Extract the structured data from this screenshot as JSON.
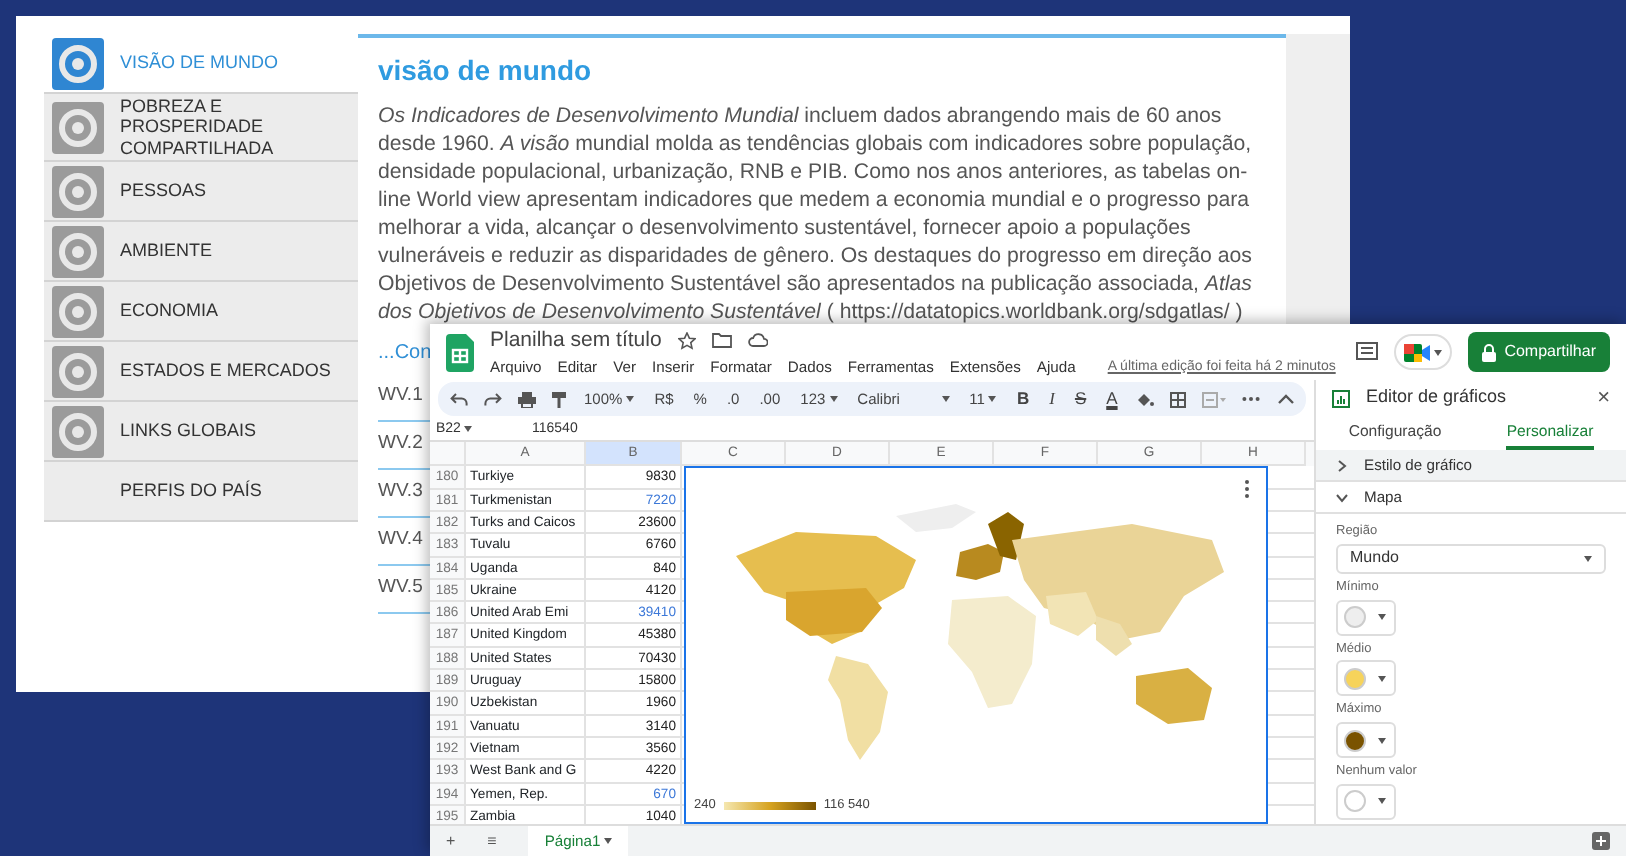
{
  "webpage": {
    "sidebar": [
      {
        "label": "VISÃO DE MUNDO",
        "kind": "icon",
        "selected": true
      },
      {
        "label": "POBREZA E PROSPERIDADE COMPARTILHADA",
        "kind": "icon",
        "selected": false
      },
      {
        "label": "PESSOAS",
        "kind": "icon",
        "selected": false
      },
      {
        "label": "AMBIENTE",
        "kind": "icon",
        "selected": false
      },
      {
        "label": "ECONOMIA",
        "kind": "icon",
        "selected": false
      },
      {
        "label": "ESTADOS E MERCADOS",
        "kind": "icon",
        "selected": false
      },
      {
        "label": "LINKS GLOBAIS",
        "kind": "icon",
        "selected": false
      },
      {
        "label": "PERFIS DO PAÍS",
        "kind": "text",
        "selected": false
      }
    ],
    "title": "visão de mundo",
    "paragraph": "*Os Indicadores de Desenvolvimento Mundial* incluem dados abrangendo mais de 60 anos desde 1960. *A visão* mundial molda as tendências globais com indicadores sobre população, densidade populacional, urbanização, RNB e PIB. Como nos anos anteriores, as tabelas on-line World view apresentam indicadores que medem a economia mundial e o progresso para melhorar a vida, alcançar o desenvolvimento sustentável, fornecer apoio a populações vulneráveis e reduzir as disparidades de gênero. Os destaques do progresso em direção aos Objetivos de Desenvolvimento Sustentável são apresentados na publicação associada, *Atlas dos Objetivos de Desenvolvimento Sustentável* (",
    "link": "https://datatopics.worldbank.org/sdgatlas/",
    "link_suffix": ")",
    "more_link": "...Con",
    "table_labels": [
      "WV.1",
      "WV.2",
      "WV.3",
      "WV.4",
      "WV.5"
    ]
  },
  "sheets": {
    "title": "Planilha sem título",
    "menu": [
      "Arquivo",
      "Editar",
      "Ver",
      "Inserir",
      "Formatar",
      "Dados",
      "Ferramentas",
      "Extensões",
      "Ajuda"
    ],
    "last_edit": "A última edição foi feita há 2 minutos",
    "share_button": "Compartilhar",
    "toolbar": [
      {
        "kind": "dropdown",
        "text": "100%"
      },
      {
        "kind": "button",
        "text": "R$"
      },
      {
        "kind": "button",
        "text": "%"
      },
      {
        "kind": "button",
        "text": ".0"
      },
      {
        "kind": "button",
        "text": ".00"
      },
      {
        "kind": "dropdown",
        "text": "123"
      },
      {
        "kind": "dropdown",
        "text": "Calibri"
      },
      {
        "kind": "dropdown",
        "text": "11"
      }
    ],
    "format_buttons": [
      "B",
      "I",
      "S",
      "A"
    ],
    "cell_ref": "B22",
    "formula": "116540",
    "columns": [
      {
        "label": "A",
        "selected": false
      },
      {
        "label": "B",
        "selected": true
      },
      {
        "label": "C",
        "selected": false
      },
      {
        "label": "D",
        "selected": false
      },
      {
        "label": "E",
        "selected": false
      },
      {
        "label": "F",
        "selected": false
      },
      {
        "label": "G",
        "selected": false
      },
      {
        "label": "H",
        "selected": false
      }
    ],
    "rows": [
      {
        "num": "180",
        "name": "Turkiye",
        "value": "9830",
        "color": "#222222"
      },
      {
        "num": "181",
        "name": "Turkmenistan",
        "value": "7220",
        "color": "#3c78d8"
      },
      {
        "num": "182",
        "name": "Turks and Caicos",
        "value": "23600",
        "color": "#222222"
      },
      {
        "num": "183",
        "name": "Tuvalu",
        "value": "6760",
        "color": "#222222"
      },
      {
        "num": "184",
        "name": "Uganda",
        "value": "840",
        "color": "#222222"
      },
      {
        "num": "185",
        "name": "Ukraine",
        "value": "4120",
        "color": "#222222"
      },
      {
        "num": "186",
        "name": "United Arab Emi",
        "value": "39410",
        "color": "#3c78d8"
      },
      {
        "num": "187",
        "name": "United Kingdom",
        "value": "45380",
        "color": "#222222"
      },
      {
        "num": "188",
        "name": "United States",
        "value": "70430",
        "color": "#222222"
      },
      {
        "num": "189",
        "name": "Uruguay",
        "value": "15800",
        "color": "#222222"
      },
      {
        "num": "190",
        "name": "Uzbekistan",
        "value": "1960",
        "color": "#222222"
      },
      {
        "num": "191",
        "name": "Vanuatu",
        "value": "3140",
        "color": "#222222"
      },
      {
        "num": "192",
        "name": "Vietnam",
        "value": "3560",
        "color": "#222222"
      },
      {
        "num": "193",
        "name": "West Bank and G",
        "value": "4220",
        "color": "#222222"
      },
      {
        "num": "194",
        "name": "Yemen, Rep.",
        "value": "670",
        "color": "#3c78d8"
      },
      {
        "num": "195",
        "name": "Zambia",
        "value": "1040",
        "color": "#222222"
      }
    ],
    "legend": {
      "min": "240",
      "max": "116 540"
    },
    "add_sheet": "+",
    "sheet_list": "≡",
    "sheet_tabs": [
      {
        "label": "Página1",
        "selected": true
      }
    ],
    "editor": {
      "title": "Editor de gráficos",
      "close": "×",
      "tabs": [
        {
          "label": "Configuração",
          "selected": false
        },
        {
          "label": "Personalizar",
          "selected": true
        }
      ],
      "sections": [
        {
          "label": "Estilo de gráfico",
          "expanded": false
        },
        {
          "label": "Mapa",
          "expanded": true
        }
      ],
      "region_label": "Região",
      "region_value": "Mundo",
      "colors": [
        {
          "label": "Mínimo",
          "color": "#eeeeee"
        },
        {
          "label": "Médio",
          "color": "#f6d35b"
        },
        {
          "label": "Máximo",
          "color": "#7a5300"
        },
        {
          "label": "Nenhum valor",
          "color": "#ffffff"
        }
      ]
    }
  }
}
